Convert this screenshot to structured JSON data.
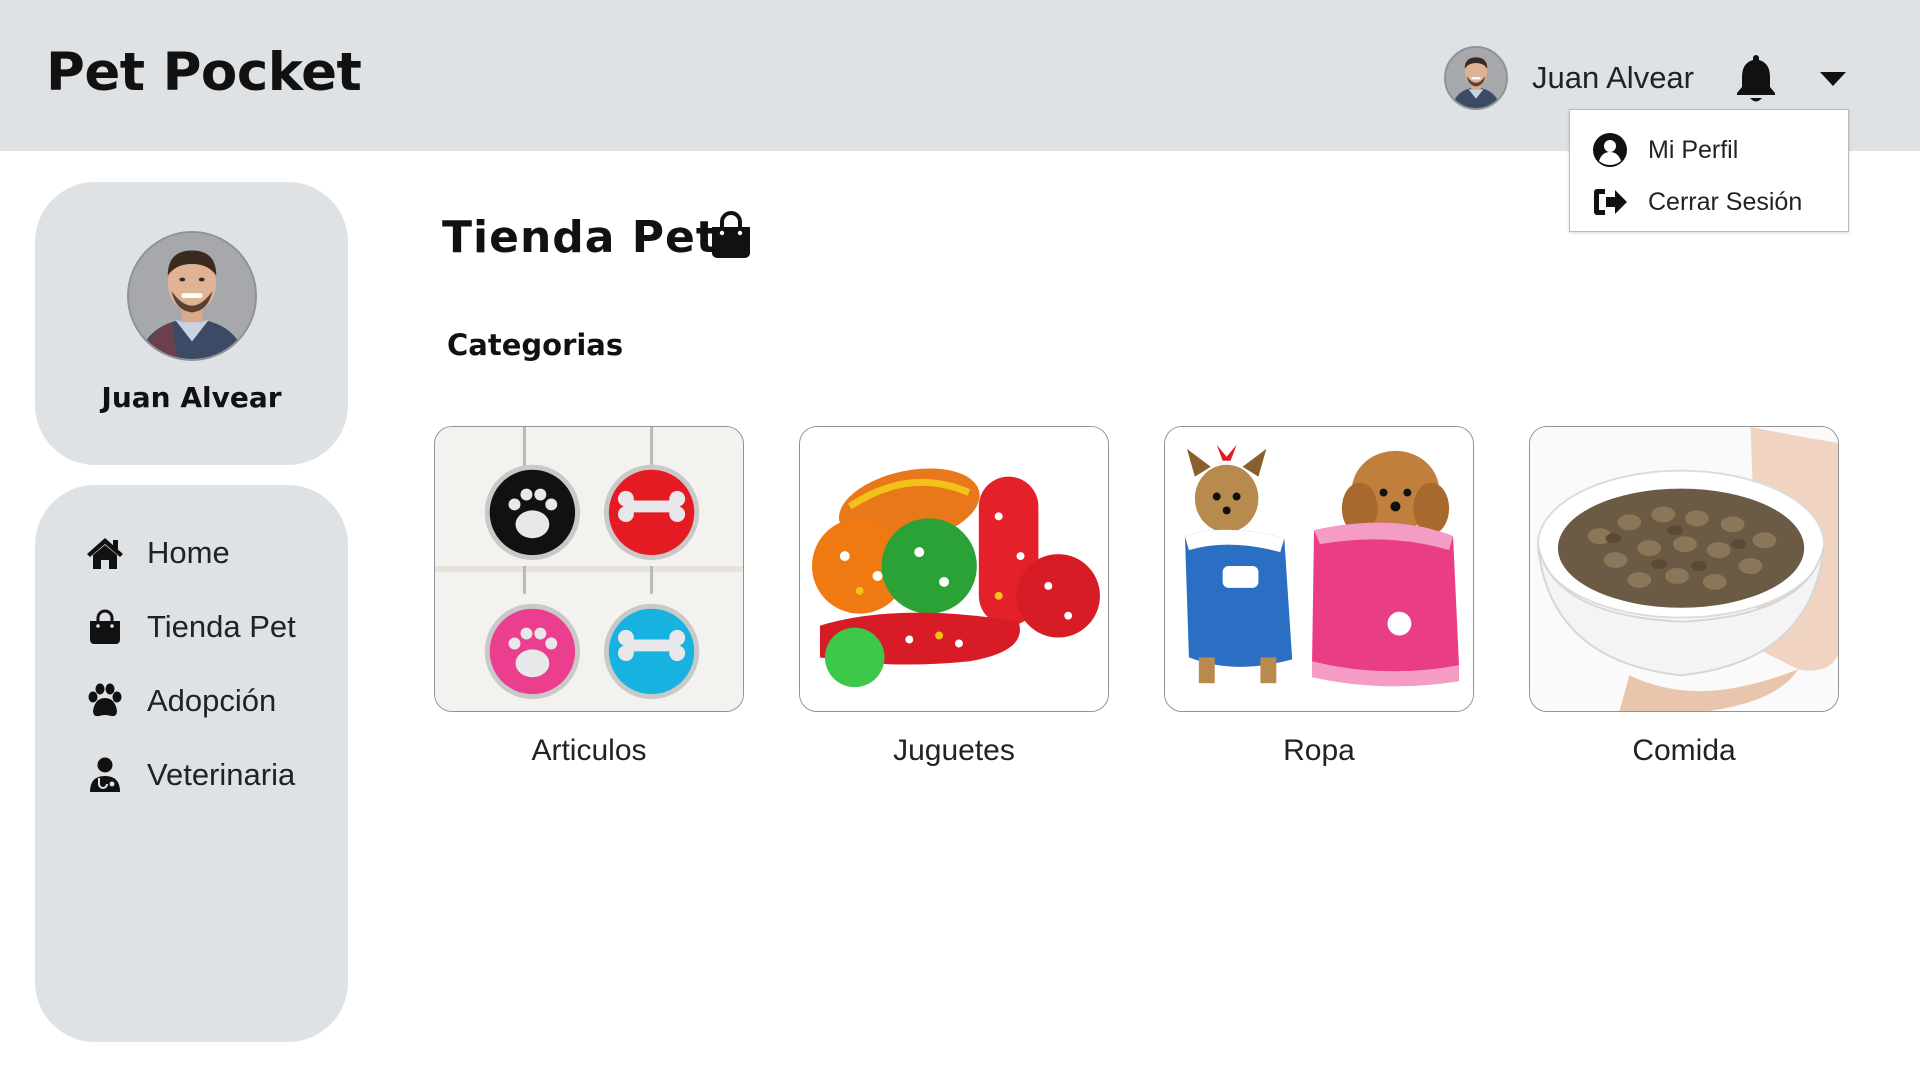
{
  "app": {
    "brand": "Pet Pocket"
  },
  "header": {
    "username": "Juan Alvear",
    "avatar_icon": "user-photo",
    "bell_icon": "bell-icon",
    "caret_icon": "chevron-down-icon"
  },
  "dropdown": {
    "items": [
      {
        "label": "Mi Perfil",
        "icon": "user-circle-icon"
      },
      {
        "label": "Cerrar Sesión",
        "icon": "sign-out-icon"
      }
    ]
  },
  "profile": {
    "name": "Juan Alvear"
  },
  "sidebar": {
    "items": [
      {
        "label": "Home",
        "icon": "home-icon"
      },
      {
        "label": "Tienda Pet",
        "icon": "shopping-bag-icon"
      },
      {
        "label": "Adopción",
        "icon": "paw-icon"
      },
      {
        "label": "Veterinaria",
        "icon": "doctor-icon"
      }
    ]
  },
  "main": {
    "title": "Tienda Pet",
    "title_icon": "shopping-bag-icon",
    "section_title": "Categorias",
    "categories": [
      {
        "label": "Articulos",
        "image": "pet-tags-photo"
      },
      {
        "label": "Juguetes",
        "image": "dog-toys-photo"
      },
      {
        "label": "Ropa",
        "image": "dog-clothes-photo"
      },
      {
        "label": "Comida",
        "image": "dog-food-bowl-photo"
      }
    ]
  },
  "colors": {
    "panel": "#dfe2e5",
    "background": "#ffffff",
    "text": "#111111"
  }
}
